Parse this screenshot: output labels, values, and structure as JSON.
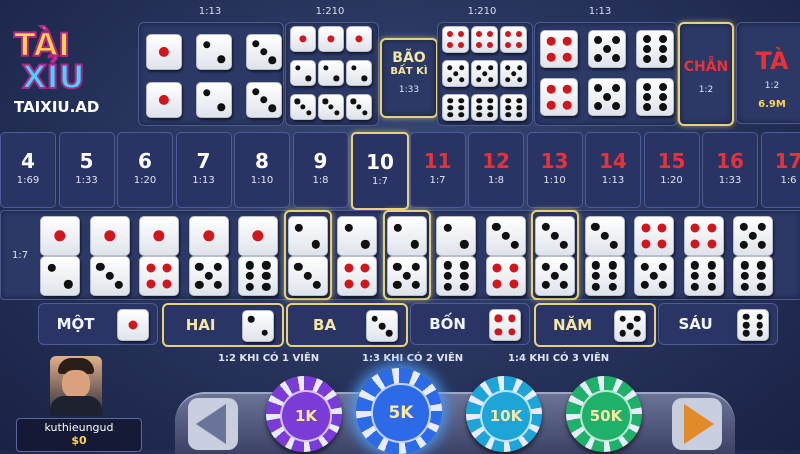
{
  "logo": {
    "line1": "TÀI",
    "line2": "XỈU",
    "site": "TAIXIU.AD"
  },
  "top_odds": {
    "single": "1:13",
    "triple_specific": "1:210",
    "triple_alt": "1:210",
    "double": "1:13"
  },
  "bao": {
    "title": "BÃO",
    "subtitle": "BẤT KÌ",
    "odds": "1:33"
  },
  "chan": {
    "label": "CHẴN",
    "odds": "1:2"
  },
  "tai": {
    "label": "TÀ",
    "odds": "1:2",
    "amount": "6.9M"
  },
  "sums": [
    {
      "num": "4",
      "odds": "1:69"
    },
    {
      "num": "5",
      "odds": "1:33"
    },
    {
      "num": "6",
      "odds": "1:20"
    },
    {
      "num": "7",
      "odds": "1:13"
    },
    {
      "num": "8",
      "odds": "1:10"
    },
    {
      "num": "9",
      "odds": "1:8"
    },
    {
      "num": "10",
      "odds": "1:7"
    },
    {
      "num": "11",
      "odds": "1:7"
    },
    {
      "num": "12",
      "odds": "1:8"
    },
    {
      "num": "13",
      "odds": "1:10"
    },
    {
      "num": "14",
      "odds": "1:13"
    },
    {
      "num": "15",
      "odds": "1:20"
    },
    {
      "num": "16",
      "odds": "1:33"
    },
    {
      "num": "17",
      "odds": "1:6"
    }
  ],
  "combo_odds": "1:7",
  "single_bets": [
    {
      "label": "MỘT",
      "face": 1
    },
    {
      "label": "HAI",
      "face": 2
    },
    {
      "label": "BA",
      "face": 3
    },
    {
      "label": "BỐN",
      "face": 4
    },
    {
      "label": "NĂM",
      "face": 5
    },
    {
      "label": "SÁU",
      "face": 6
    }
  ],
  "hints": [
    "1:2 KHI CÓ 1 VIÊN",
    "1:3 KHI CÓ 2 VIÊN",
    "1:4 KHI CÓ 3 VIÊN"
  ],
  "player": {
    "name": "kuthieungud",
    "balance": "$0"
  },
  "chips": [
    {
      "label": "1K",
      "color": "#7a3bd6"
    },
    {
      "label": "5K",
      "color": "#2d6ae8"
    },
    {
      "label": "10K",
      "color": "#1ea5d8"
    },
    {
      "label": "50K",
      "color": "#1fb06a"
    }
  ]
}
